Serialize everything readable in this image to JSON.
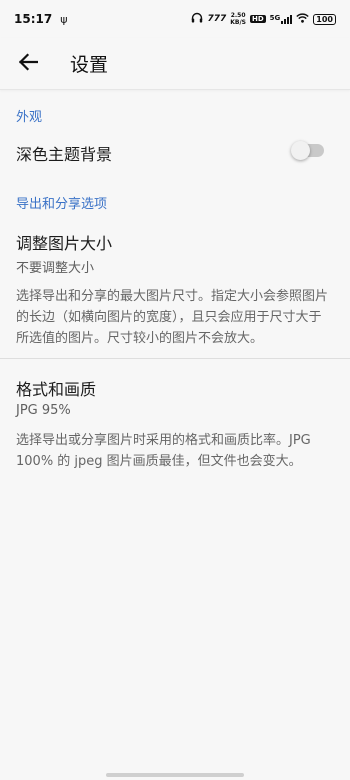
{
  "status_bar": {
    "time": "15:17",
    "speed_top": "2.50",
    "speed_bottom": "KB/S",
    "hd": "HD",
    "network": "5G",
    "battery": "100"
  },
  "app_bar": {
    "title": "设置"
  },
  "appearance": {
    "header": "外观",
    "dark_theme_label": "深色主题背景",
    "dark_theme_enabled": false
  },
  "export": {
    "header": "导出和分享选项",
    "resize_title": "调整图片大小",
    "resize_value": "不要调整大小",
    "resize_description": "选择导出和分享的最大图片尺寸。指定大小会参照图片的长边（如横向图片的宽度），且只会应用于尺寸大于所选值的图片。尺寸较小的图片不会放大。",
    "format_title": "格式和画质",
    "format_value": "JPG 95%",
    "format_description": "选择导出或分享图片时采用的格式和画质比率。JPG 100% 的 jpeg 图片画质最佳，但文件也会变大。"
  }
}
